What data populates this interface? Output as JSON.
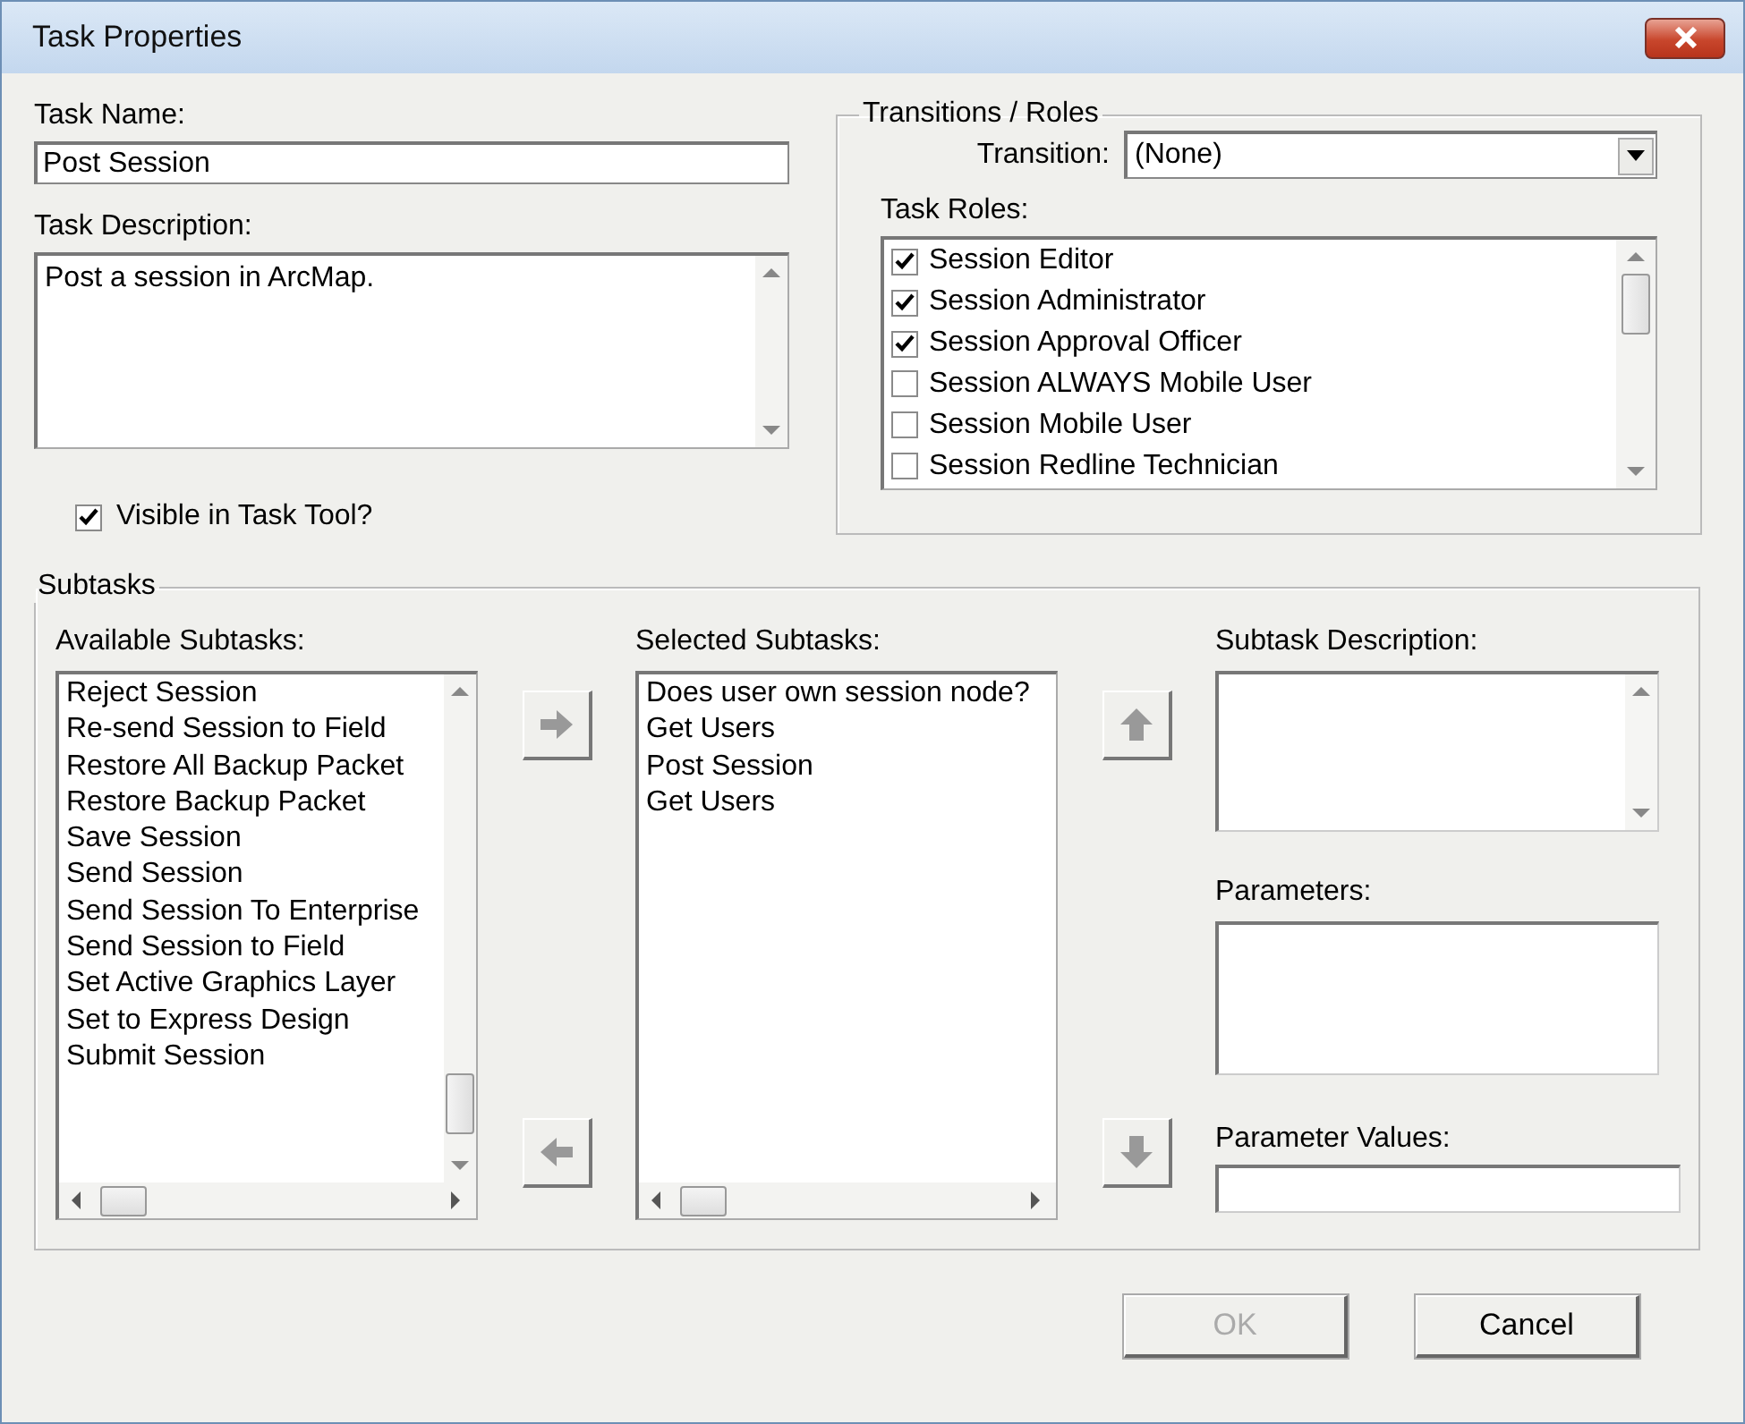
{
  "window": {
    "title": "Task Properties"
  },
  "task_name": {
    "label": "Task Name:",
    "value": "Post Session"
  },
  "task_description": {
    "label": "Task Description:",
    "value": "Post a session in ArcMap."
  },
  "visible_in_task_tool": {
    "label": "Visible in Task Tool?",
    "checked": true
  },
  "transitions_roles": {
    "title": "Transitions / Roles",
    "transition": {
      "label": "Transition:",
      "value": "(None)"
    },
    "task_roles": {
      "label": "Task Roles:",
      "items": [
        {
          "label": "Session Editor",
          "checked": true
        },
        {
          "label": "Session Administrator",
          "checked": true
        },
        {
          "label": "Session Approval Officer",
          "checked": true
        },
        {
          "label": "Session ALWAYS Mobile User",
          "checked": false
        },
        {
          "label": "Session Mobile User",
          "checked": false
        },
        {
          "label": "Session Redline Technician",
          "checked": false
        }
      ]
    }
  },
  "subtasks": {
    "title": "Subtasks",
    "available": {
      "label": "Available Subtasks:",
      "items": [
        "Reject Session",
        "Re-send Session to Field",
        "Restore All Backup Packet",
        "Restore Backup Packet",
        "Save Session",
        "Send Session",
        "Send Session To Enterprise",
        "Send Session to Field",
        "Set Active Graphics Layer",
        "Set to Express Design",
        "Submit Session"
      ]
    },
    "selected": {
      "label": "Selected Subtasks:",
      "items": [
        "Does user own session node?",
        "Get Users",
        "Post Session",
        "Get Users"
      ]
    },
    "subtask_description": {
      "label": "Subtask Description:"
    },
    "parameters": {
      "label": "Parameters:"
    },
    "parameter_values": {
      "label": "Parameter Values:"
    }
  },
  "buttons": [
    {
      "label": "OK",
      "disabled": true
    },
    {
      "label": "Cancel",
      "disabled": false
    }
  ]
}
